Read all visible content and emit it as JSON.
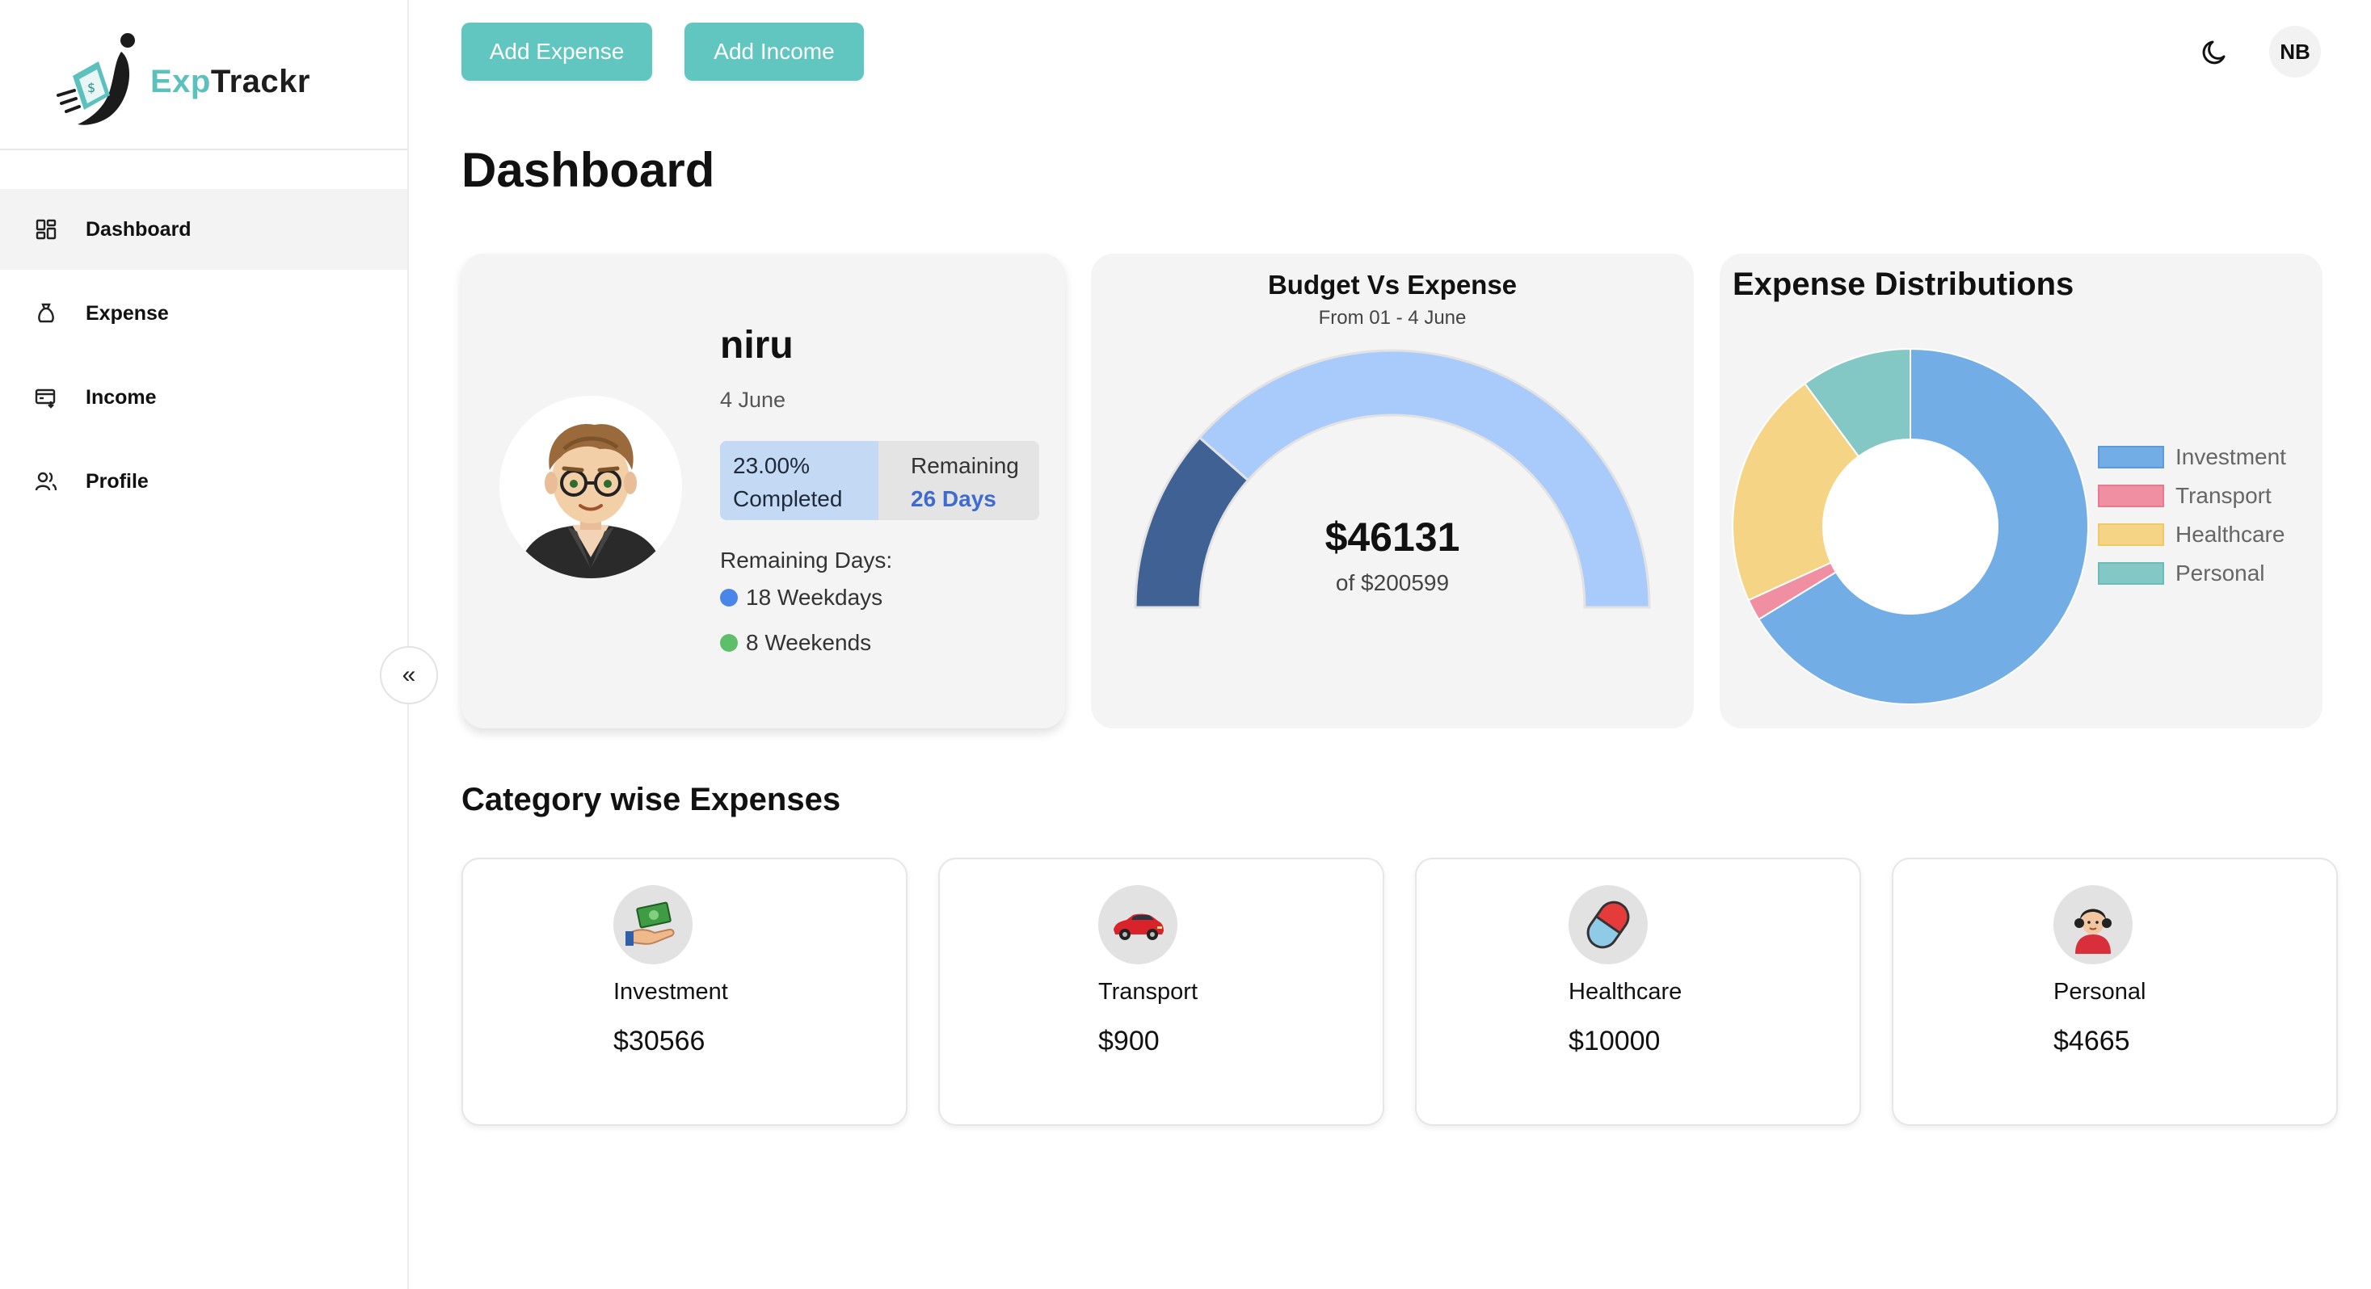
{
  "app": {
    "name_part1": "Exp",
    "name_part2": "Trackr"
  },
  "sidebar": {
    "items": [
      {
        "label": "Dashboard",
        "icon": "dashboard-grid-icon",
        "active": true
      },
      {
        "label": "Expense",
        "icon": "money-bag-icon",
        "active": false
      },
      {
        "label": "Income",
        "icon": "income-card-icon",
        "active": false
      },
      {
        "label": "Profile",
        "icon": "users-icon",
        "active": false
      }
    ],
    "collapse_glyph": "«"
  },
  "topbar": {
    "add_expense": "Add Expense",
    "add_income": "Add Income",
    "theme_icon": "moon-icon",
    "user_initials": "NB",
    "accent_color": "#62c6c0"
  },
  "page_title": "Dashboard",
  "profile_card": {
    "name": "niru",
    "date": "4 June",
    "completed_percent": "23.00%",
    "completed_label": "Completed",
    "remaining_label": "Remaining",
    "remaining_days": "26 Days",
    "remaining_days_label": "Remaining Days:",
    "weekdays": "18 Weekdays",
    "weekends": "8 Weekends",
    "weekday_dot_color": "#4a86e8",
    "weekend_dot_color": "#5dbf6a"
  },
  "budget_card": {
    "title": "Budget Vs Expense",
    "subtitle": "From 01 - 4 June",
    "spent_display": "$46131",
    "budget_display": "of $200599",
    "gauge": {
      "spent": 46131,
      "budget": 200599,
      "spent_color": "#3f6194",
      "remaining_color": "#a9cbfb"
    }
  },
  "distribution_card": {
    "title": "Expense Distributions",
    "chart_data": {
      "type": "pie",
      "variant": "donut",
      "labels": [
        "Investment",
        "Transport",
        "Healthcare",
        "Personal"
      ],
      "values": [
        30566,
        900,
        10000,
        4665
      ],
      "colors": [
        "#72ade6",
        "#ef8fa1",
        "#f6d485",
        "#83c8c5"
      ],
      "border_colors": [
        "#5b9bdc",
        "#e8798f",
        "#f0c866",
        "#6bbcb8"
      ],
      "legend_position": "right"
    }
  },
  "category_section": {
    "title": "Category wise Expenses",
    "items": [
      {
        "name": "Investment",
        "amount": "$30566",
        "icon": "money-hand-icon"
      },
      {
        "name": "Transport",
        "amount": "$900",
        "icon": "red-car-icon"
      },
      {
        "name": "Healthcare",
        "amount": "$10000",
        "icon": "pill-capsule-icon"
      },
      {
        "name": "Personal",
        "amount": "$4665",
        "icon": "person-avatar-icon"
      }
    ]
  }
}
